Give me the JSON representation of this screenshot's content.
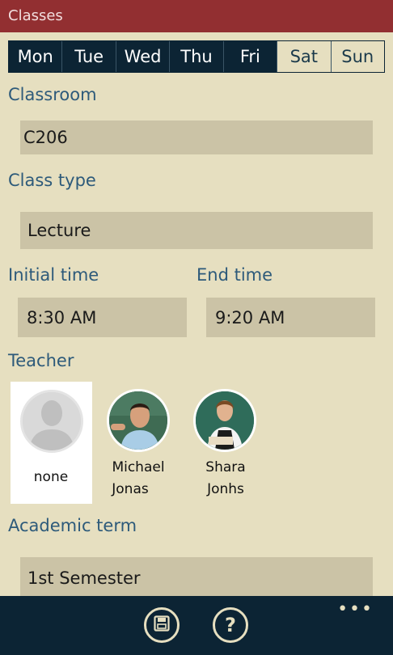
{
  "title_bar": {
    "title": "Classes"
  },
  "days": [
    {
      "label": "Mon",
      "selected": true
    },
    {
      "label": "Tue",
      "selected": true
    },
    {
      "label": "Wed",
      "selected": true
    },
    {
      "label": "Thu",
      "selected": true
    },
    {
      "label": "Fri",
      "selected": true
    },
    {
      "label": "Sat",
      "selected": false
    },
    {
      "label": "Sun",
      "selected": false
    }
  ],
  "form": {
    "classroom_label": "Classroom",
    "classroom_value": "C206",
    "class_type_label": "Class type",
    "class_type_value": "Lecture",
    "initial_time_label": "Initial time",
    "initial_time_value": "8:30 AM",
    "end_time_label": "End time",
    "end_time_value": "9:20 AM",
    "teacher_label": "Teacher",
    "academic_term_label": "Academic term",
    "academic_term_value": "1st Semester"
  },
  "teachers": [
    {
      "name_line1": "none",
      "name_line2": "",
      "selected": true
    },
    {
      "name_line1": "Michael",
      "name_line2": "Jonas",
      "selected": false
    },
    {
      "name_line1": "Shara",
      "name_line2": "Jonhs",
      "selected": false
    }
  ],
  "app_bar": {
    "save_icon": "save-icon",
    "help_icon": "help-icon",
    "more_label": "•••"
  },
  "colors": {
    "title_bar": "#922f31",
    "background": "#e6dfc0",
    "accent_text": "#2d5a7a",
    "field": "#cbc3a6",
    "app_bar": "#0c2434"
  }
}
